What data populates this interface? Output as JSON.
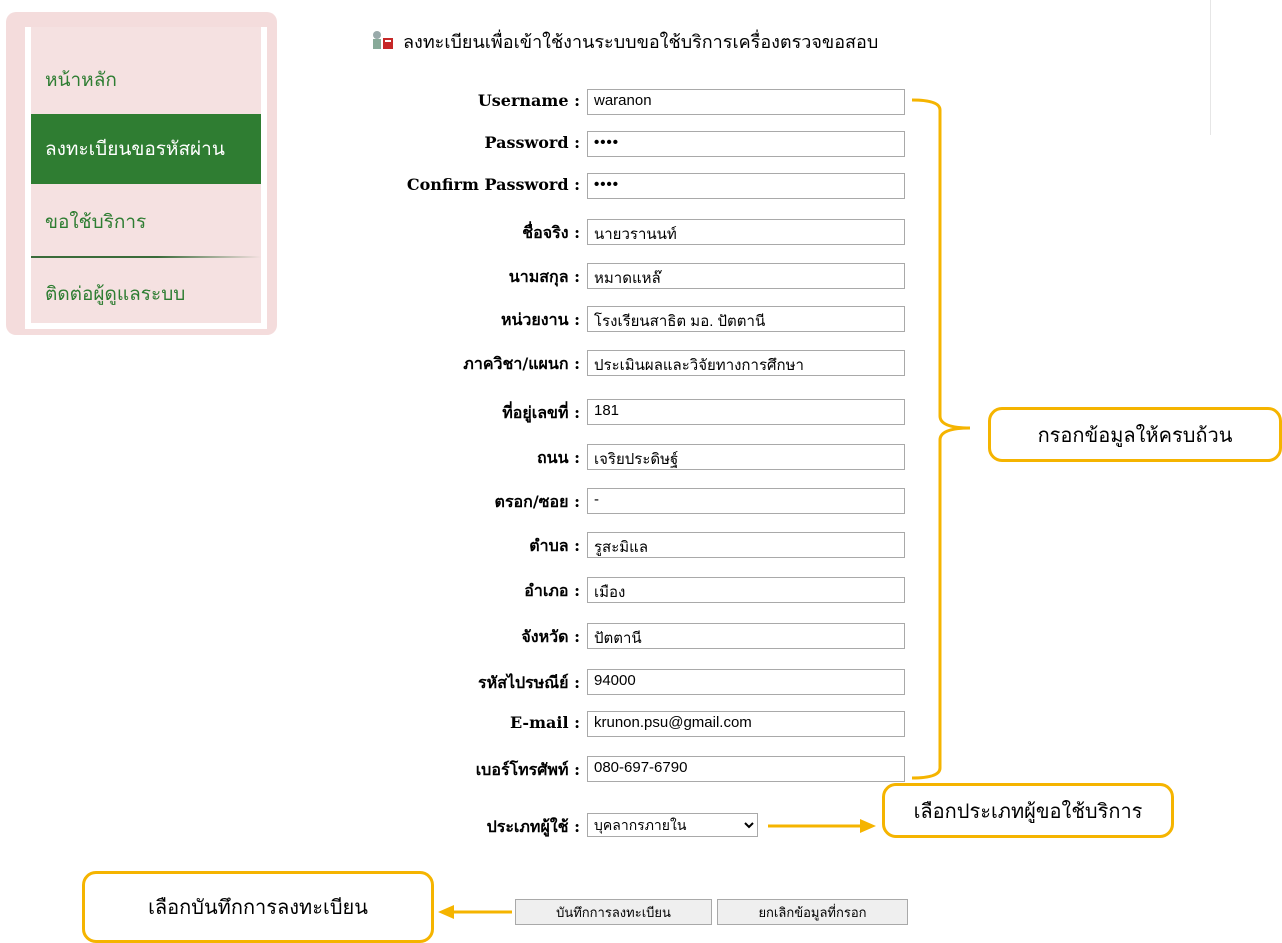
{
  "sidebar": {
    "items": [
      {
        "label": "หน้าหลัก",
        "active": false
      },
      {
        "label": "ลงทะเบียนขอรหัสผ่าน",
        "active": true
      },
      {
        "label": "ขอใช้บริการ",
        "active": false
      },
      {
        "label": "ติดต่อผู้ดูแลระบบ",
        "active": false
      }
    ]
  },
  "header": {
    "title": "ลงทะเบียนเพื่อเข้าใช้งานระบบขอใช้บริการเครื่องตรวจขอสอบ",
    "icon": "user-register-icon"
  },
  "form": {
    "fields": [
      {
        "label": "Username :",
        "value": "waranon"
      },
      {
        "label": "Password :",
        "value": "••••"
      },
      {
        "label": "Confirm Password :",
        "value": "••••"
      },
      {
        "label": "ชื่อจริง :",
        "value": "นายวรานนท์"
      },
      {
        "label": "นามสกุล :",
        "value": "หมาดแหล๊"
      },
      {
        "label": "หน่วยงาน :",
        "value": "โรงเรียนสาธิต มอ. ปัตตานี"
      },
      {
        "label": "ภาควิชา/แผนก :",
        "value": "ประเมินผลและวิจัยทางการศึกษา"
      },
      {
        "label": "ที่อยู่เลขที่ :",
        "value": "181"
      },
      {
        "label": "ถนน :",
        "value": "เจริยประดิษฐ์"
      },
      {
        "label": "ตรอก/ซอย :",
        "value": "-"
      },
      {
        "label": "ตำบล :",
        "value": "รูสะมิแล"
      },
      {
        "label": "อำเภอ :",
        "value": "เมือง"
      },
      {
        "label": "จังหวัด :",
        "value": "ปัตตานี"
      },
      {
        "label": "รหัสไปรษณีย์ :",
        "value": "94000"
      },
      {
        "label": "E-mail :",
        "value": "krunon.psu@gmail.com"
      },
      {
        "label": "เบอร์โทรศัพท์ :",
        "value": "080-697-6790"
      }
    ],
    "user_type": {
      "label": "ประเภทผู้ใช้ :",
      "selected": "บุคลากรภายใน"
    },
    "buttons": {
      "save": "บันทึกการลงทะเบียน",
      "cancel": "ยกเลิกข้อมูลที่กรอก"
    }
  },
  "callouts": {
    "fill_all": "กรอกข้อมูลให้ครบถ้วน",
    "choose_type": "เลือกประเภทผู้ขอใช้บริการ",
    "choose_save": "เลือกบันทึกการลงทะเบียน"
  },
  "colors": {
    "sidebar_bg": "#f4dcdc",
    "active_green": "#2f7d32",
    "callout_border": "#f5b400"
  }
}
